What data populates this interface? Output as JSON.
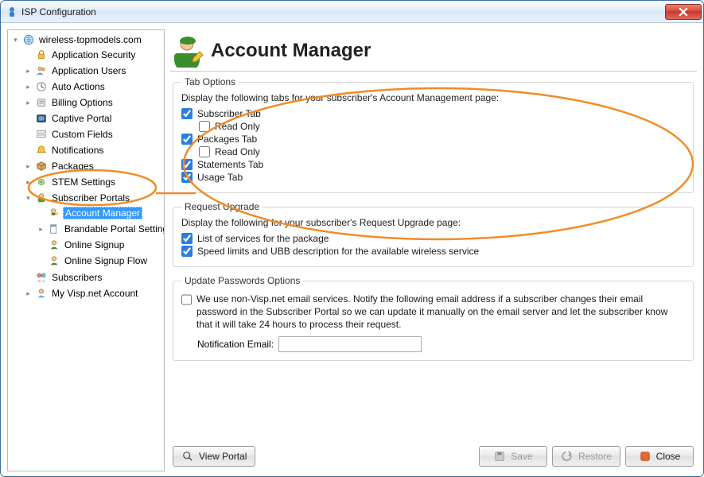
{
  "window": {
    "title": "ISP Configuration"
  },
  "tree": {
    "root": {
      "label": "wireless-topmodels.com",
      "children": [
        {
          "label": "Application Security"
        },
        {
          "label": "Application Users"
        },
        {
          "label": "Auto Actions"
        },
        {
          "label": "Billing Options"
        },
        {
          "label": "Captive Portal"
        },
        {
          "label": "Custom Fields"
        },
        {
          "label": "Notifications"
        },
        {
          "label": "Packages"
        },
        {
          "label": "STEM Settings"
        },
        {
          "label": "Subscriber Portals",
          "children": [
            {
              "label": "Account Manager",
              "selected": true
            },
            {
              "label": "Brandable Portal Settings"
            },
            {
              "label": "Online Signup"
            },
            {
              "label": "Online Signup Flow"
            }
          ]
        },
        {
          "label": "Subscribers"
        },
        {
          "label": "My Visp.net Account"
        }
      ]
    }
  },
  "page": {
    "title": "Account Manager",
    "tabOptions": {
      "legend": "Tab Options",
      "desc": "Display the following tabs for your subscriber's Account Management page:",
      "subscriber": "Subscriber Tab",
      "subscriber_readonly": "Read Only",
      "packages": "Packages Tab",
      "packages_readonly": "Read Only",
      "statements": "Statements Tab",
      "usage": "Usage Tab"
    },
    "requestUpgrade": {
      "legend": "Request Upgrade",
      "desc": "Display the following for your subscriber's Request Upgrade page:",
      "opt1": "List of services for the package",
      "opt2": "Speed limits and UBB description for the available wireless service"
    },
    "updatePasswords": {
      "legend": "Update Passwords Options",
      "opt_desc": "We use non-Visp.net email services. Notify the following email address if a subscriber changes their email password in the Subscriber Portal so we can update it manually on the email server and let the subscriber know that it will take 24 hours to process their request.",
      "notify_label": "Notification Email:",
      "notify_value": ""
    }
  },
  "footer": {
    "viewPortal": "View Portal",
    "save": "Save",
    "restore": "Restore",
    "close": "Close"
  }
}
